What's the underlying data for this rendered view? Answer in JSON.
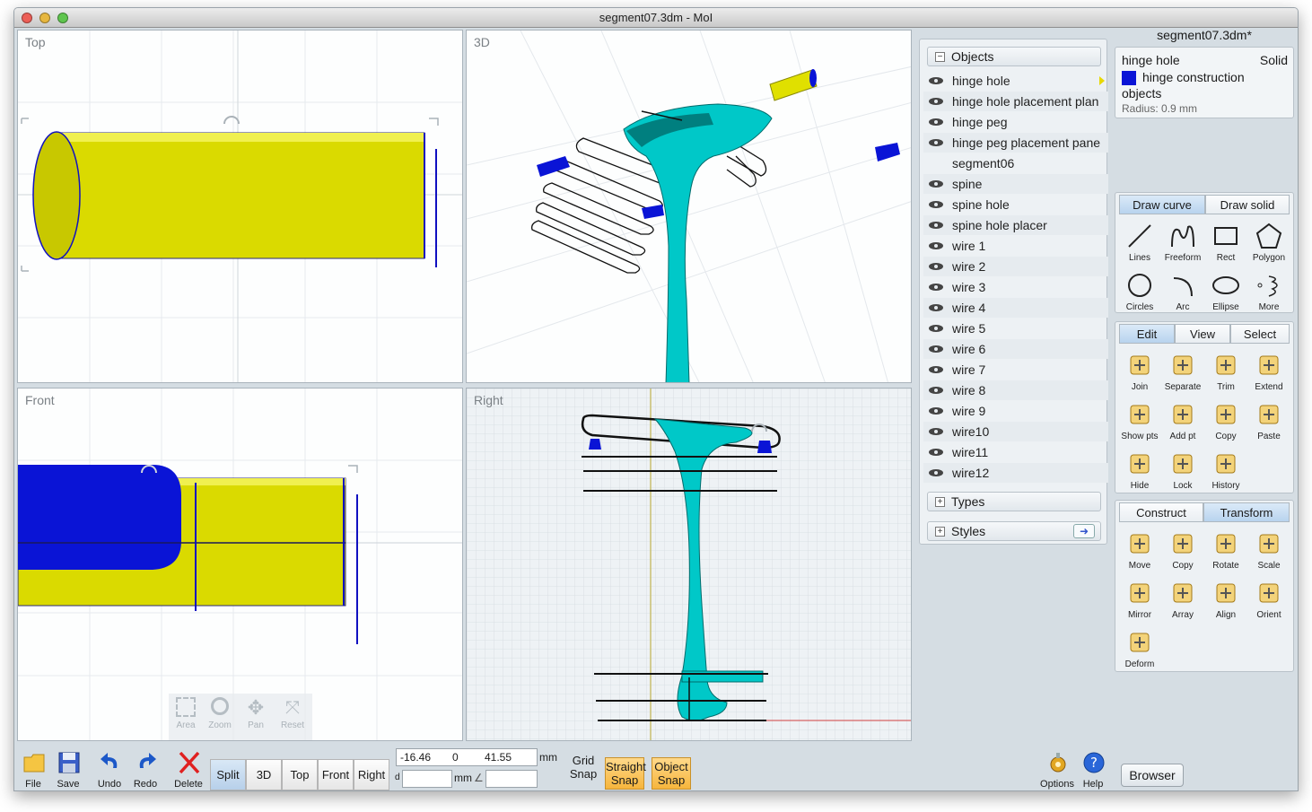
{
  "window": {
    "title": "segment07.3dm - MoI"
  },
  "viewports": {
    "top": "Top",
    "three_d": "3D",
    "front": "Front",
    "right": "Right"
  },
  "view_controls": {
    "area": "Area",
    "zoom": "Zoom",
    "pan": "Pan",
    "reset": "Reset"
  },
  "objects_panel": {
    "header": "Objects",
    "items": [
      "hinge hole",
      "hinge hole placement plan",
      "hinge peg",
      "hinge peg placement pane",
      "segment06",
      "spine",
      "spine hole",
      "spine hole placer",
      "wire 1",
      "wire 2",
      "wire 3",
      "wire 4",
      "wire 5",
      "wire 6",
      "wire 7",
      "wire 8",
      "wire 9",
      "wire10",
      "wire11",
      "wire12"
    ],
    "types": "Types",
    "styles": "Styles"
  },
  "properties": {
    "file": "segment07.3dm*",
    "object_name": "hinge hole",
    "object_type": "Solid",
    "style": "hinge construction",
    "style_suffix": "objects",
    "radius": "Radius: 0.9 mm",
    "style_color": "#0a14d6"
  },
  "draw_tabs": [
    "Draw curve",
    "Draw solid"
  ],
  "draw_tools": [
    "Lines",
    "Freeform",
    "Rect",
    "Polygon",
    "Circles",
    "Arc",
    "Ellipse",
    "More"
  ],
  "edit_tabs": [
    "Edit",
    "View",
    "Select"
  ],
  "edit_tools": [
    "Join",
    "Separate",
    "Trim",
    "Extend",
    "Show pts",
    "Add pt",
    "Copy",
    "Paste",
    "Hide",
    "Lock",
    "History"
  ],
  "construct_tabs": [
    "Construct",
    "Transform"
  ],
  "transform_tools": [
    "Move",
    "Copy",
    "Rotate",
    "Scale",
    "Mirror",
    "Array",
    "Align",
    "Orient",
    "Deform"
  ],
  "bottom": {
    "file": "File",
    "save": "Save",
    "undo": "Undo",
    "redo": "Redo",
    "delete": "Delete",
    "views": [
      "Split",
      "3D",
      "Top",
      "Front",
      "Right"
    ],
    "x": "-16.46",
    "y": "0",
    "z": "41.55",
    "unit": "mm",
    "d_label": "d",
    "mm2": "mm",
    "grid_snap": [
      "Grid",
      "Snap"
    ],
    "straight_snap": [
      "Straight",
      "Snap"
    ],
    "object_snap": [
      "Object",
      "Snap"
    ],
    "options": "Options",
    "help": "Help",
    "browser": "Browser"
  },
  "colors": {
    "yellow": "#dada00",
    "blue": "#0a14d6",
    "teal": "#00c8c8"
  }
}
